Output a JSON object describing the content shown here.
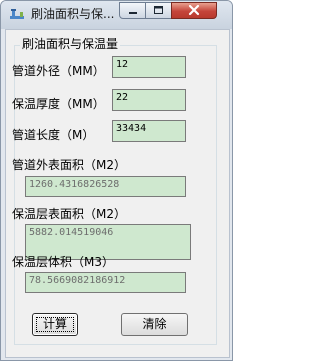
{
  "window": {
    "title": "刷油面积与保..."
  },
  "group": {
    "title": "刷油面积与保温量"
  },
  "inputs": {
    "pipe_od": {
      "label": "管道外径（MM）",
      "value": "12"
    },
    "insul_thickness": {
      "label": "保温厚度（MM）",
      "value": "22"
    },
    "pipe_length": {
      "label": "管道长度（M）",
      "value": "33434"
    }
  },
  "outputs": {
    "pipe_surface_area": {
      "label": "管道外表面积（M2）",
      "value": "1260.4316826528"
    },
    "insul_surface_area": {
      "label": "保温层表面积（M2）",
      "value": "5882.014519046"
    },
    "insul_volume": {
      "label": "保温层体积（M3）",
      "value": "78.5669082186912"
    }
  },
  "buttons": {
    "calculate": "计算",
    "clear": "清除"
  },
  "colors": {
    "field_bg": "#cfe8cf",
    "close_btn": "#c5453a"
  }
}
